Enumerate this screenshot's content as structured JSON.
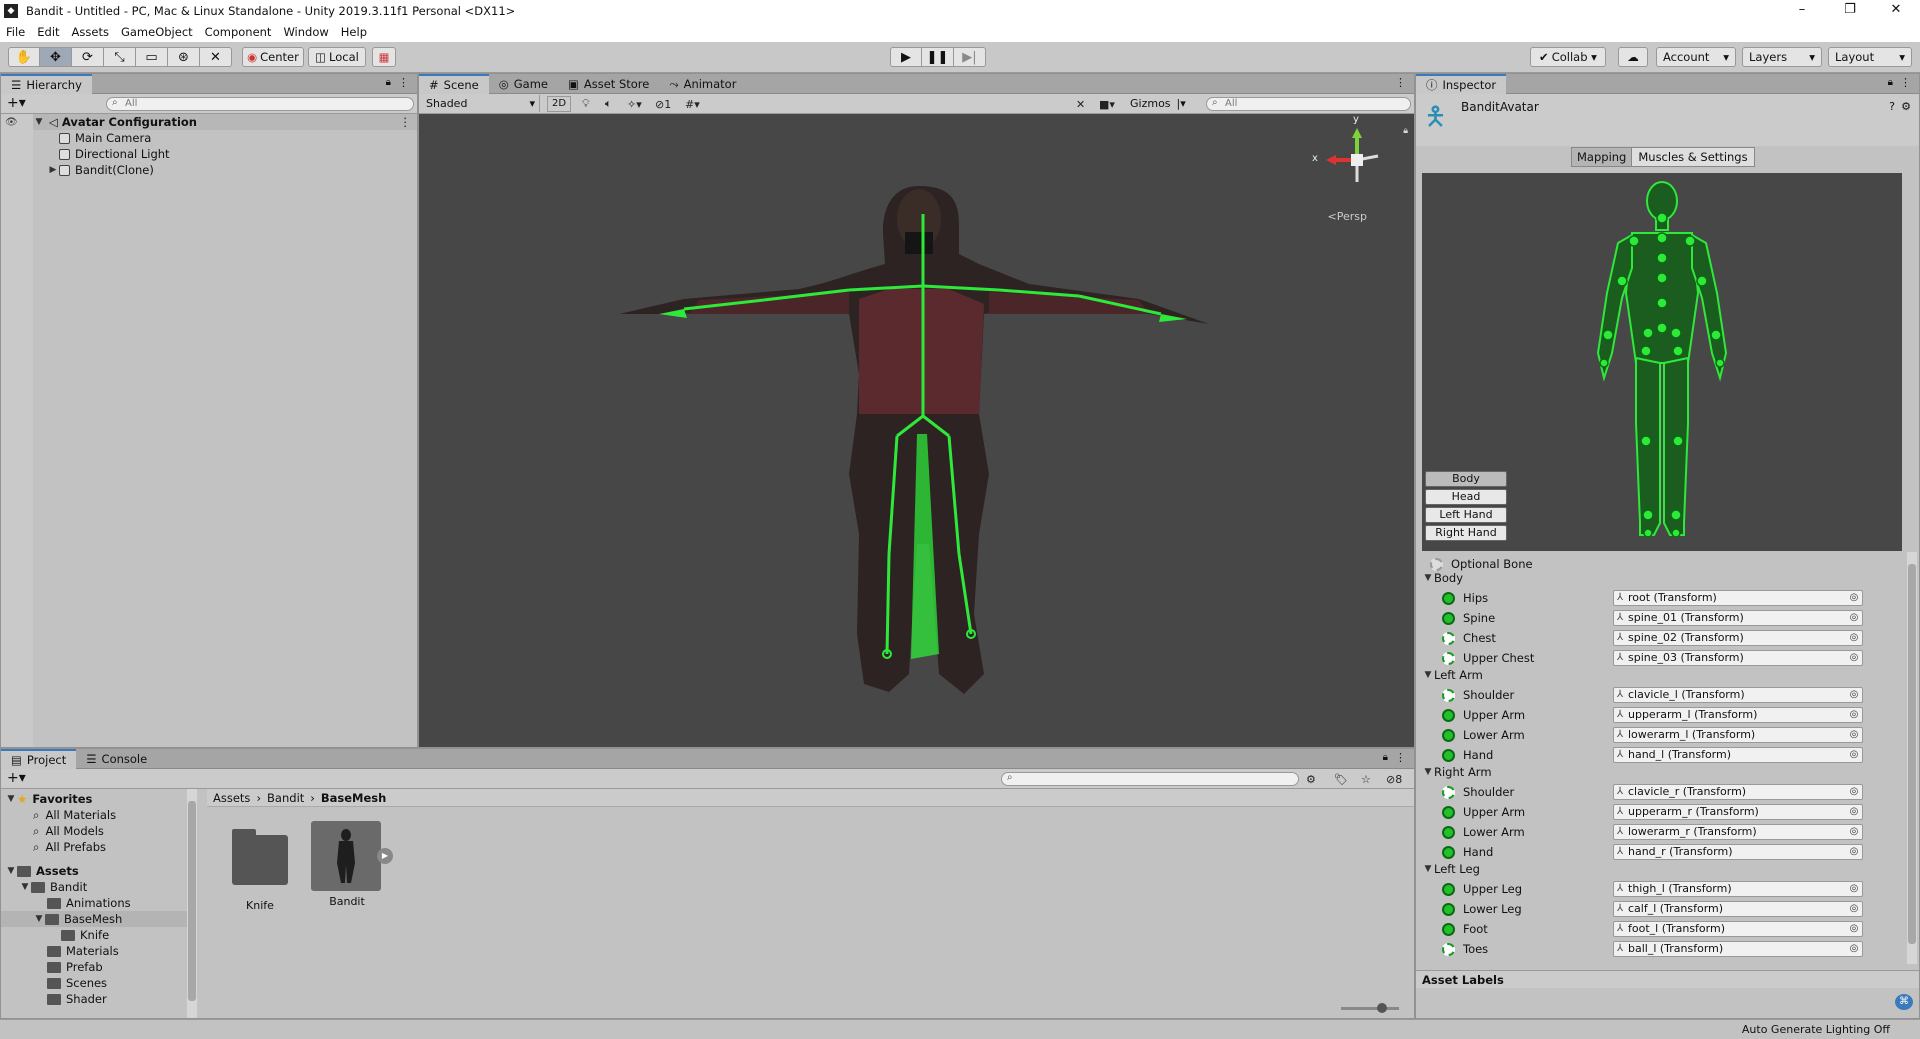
{
  "window": {
    "title": "Bandit - Untitled - PC, Mac & Linux Standalone - Unity 2019.3.11f1 Personal <DX11>"
  },
  "menu": [
    "File",
    "Edit",
    "Assets",
    "GameObject",
    "Component",
    "Window",
    "Help"
  ],
  "toolbar": {
    "pivot_label": "Center",
    "space_label": "Local",
    "collab_label": "Collab",
    "account_label": "Account",
    "layers_label": "Layers",
    "layout_label": "Layout"
  },
  "hierarchy": {
    "tab": "Hierarchy",
    "search_placeholder": "All",
    "scene": "Avatar Configuration",
    "items": [
      "Main Camera",
      "Directional Light",
      "Bandit(Clone)"
    ]
  },
  "scene": {
    "tabs": [
      "Scene",
      "Game",
      "Asset Store",
      "Animator"
    ],
    "shading": "Shaded",
    "mode_2d": "2D",
    "hidden_count": "1",
    "gizmos": "Gizmos",
    "search_placeholder": "All",
    "persp_label": "Persp",
    "axis_x": "x",
    "axis_y": "y"
  },
  "inspector": {
    "tab": "Inspector",
    "object_name": "BanditAvatar",
    "tabs": [
      "Mapping",
      "Muscles & Settings"
    ],
    "view_buttons": [
      "Body",
      "Head",
      "Left Hand",
      "Right Hand"
    ],
    "optional_bone_label": "Optional Bone",
    "sections": [
      {
        "name": "Body",
        "bones": [
          {
            "name": "Hips",
            "value": "root (Transform)",
            "optional": false
          },
          {
            "name": "Spine",
            "value": "spine_01 (Transform)",
            "optional": false
          },
          {
            "name": "Chest",
            "value": "spine_02 (Transform)",
            "optional": true
          },
          {
            "name": "Upper Chest",
            "value": "spine_03 (Transform)",
            "optional": true
          }
        ]
      },
      {
        "name": "Left Arm",
        "bones": [
          {
            "name": "Shoulder",
            "value": "clavicle_l (Transform)",
            "optional": true
          },
          {
            "name": "Upper Arm",
            "value": "upperarm_l (Transform)",
            "optional": false
          },
          {
            "name": "Lower Arm",
            "value": "lowerarm_l (Transform)",
            "optional": false
          },
          {
            "name": "Hand",
            "value": "hand_l (Transform)",
            "optional": false
          }
        ]
      },
      {
        "name": "Right Arm",
        "bones": [
          {
            "name": "Shoulder",
            "value": "clavicle_r (Transform)",
            "optional": true
          },
          {
            "name": "Upper Arm",
            "value": "upperarm_r (Transform)",
            "optional": false
          },
          {
            "name": "Lower Arm",
            "value": "lowerarm_r (Transform)",
            "optional": false
          },
          {
            "name": "Hand",
            "value": "hand_r (Transform)",
            "optional": false
          }
        ]
      },
      {
        "name": "Left Leg",
        "bones": [
          {
            "name": "Upper Leg",
            "value": "thigh_l (Transform)",
            "optional": false
          },
          {
            "name": "Lower Leg",
            "value": "calf_l (Transform)",
            "optional": false
          },
          {
            "name": "Foot",
            "value": "foot_l (Transform)",
            "optional": false
          },
          {
            "name": "Toes",
            "value": "ball_l (Transform)",
            "optional": true
          }
        ]
      }
    ],
    "asset_labels": "Asset Labels"
  },
  "project": {
    "tabs": [
      "Project",
      "Console"
    ],
    "hidden_count": "8",
    "favorites_label": "Favorites",
    "favorites": [
      "All Materials",
      "All Models",
      "All Prefabs"
    ],
    "assets_label": "Assets",
    "tree": {
      "bandit": "Bandit",
      "animations": "Animations",
      "basemesh": "BaseMesh",
      "knife": "Knife",
      "materials": "Materials",
      "prefab": "Prefab",
      "scenes": "Scenes",
      "shader": "Shader"
    },
    "breadcrumb": [
      "Assets",
      "Bandit",
      "BaseMesh"
    ],
    "grid_items": [
      "Knife",
      "Bandit"
    ]
  },
  "status": {
    "text": "Auto Generate Lighting Off"
  },
  "colors": {
    "bone_green": "#2ee83a",
    "accent": "#3a79bb",
    "scene_bg": "#474747"
  }
}
